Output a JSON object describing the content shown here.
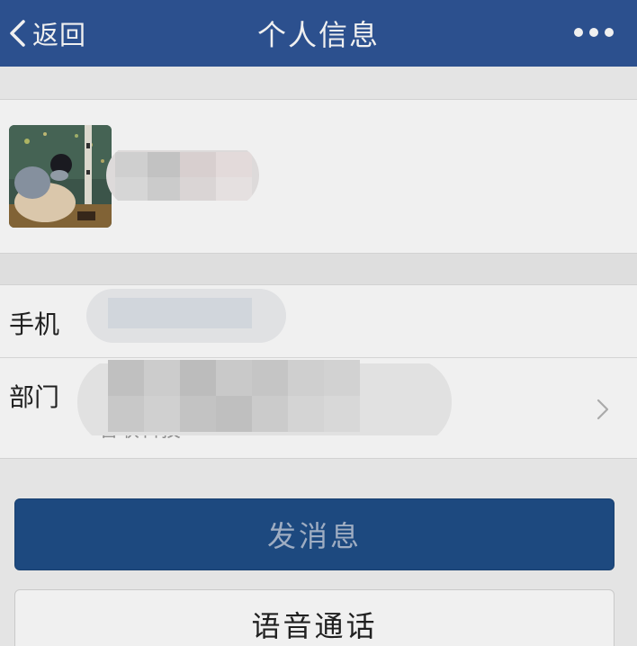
{
  "navbar": {
    "back_label": "返回",
    "title": "个人信息",
    "more_icon": "more-horizontal-icon",
    "back_icon": "chevron-left-icon",
    "bg_color": "#2f5597"
  },
  "profile": {
    "avatar_icon": "user-avatar-image",
    "name": ""
  },
  "details": {
    "phone_label": "手机",
    "department_label": "部门",
    "department_value": "智联科技",
    "chevron_icon": "chevron-right-icon"
  },
  "actions": {
    "send_message_label": "发消息",
    "voice_call_label": "语音通话",
    "primary_color": "#1f4e87"
  }
}
